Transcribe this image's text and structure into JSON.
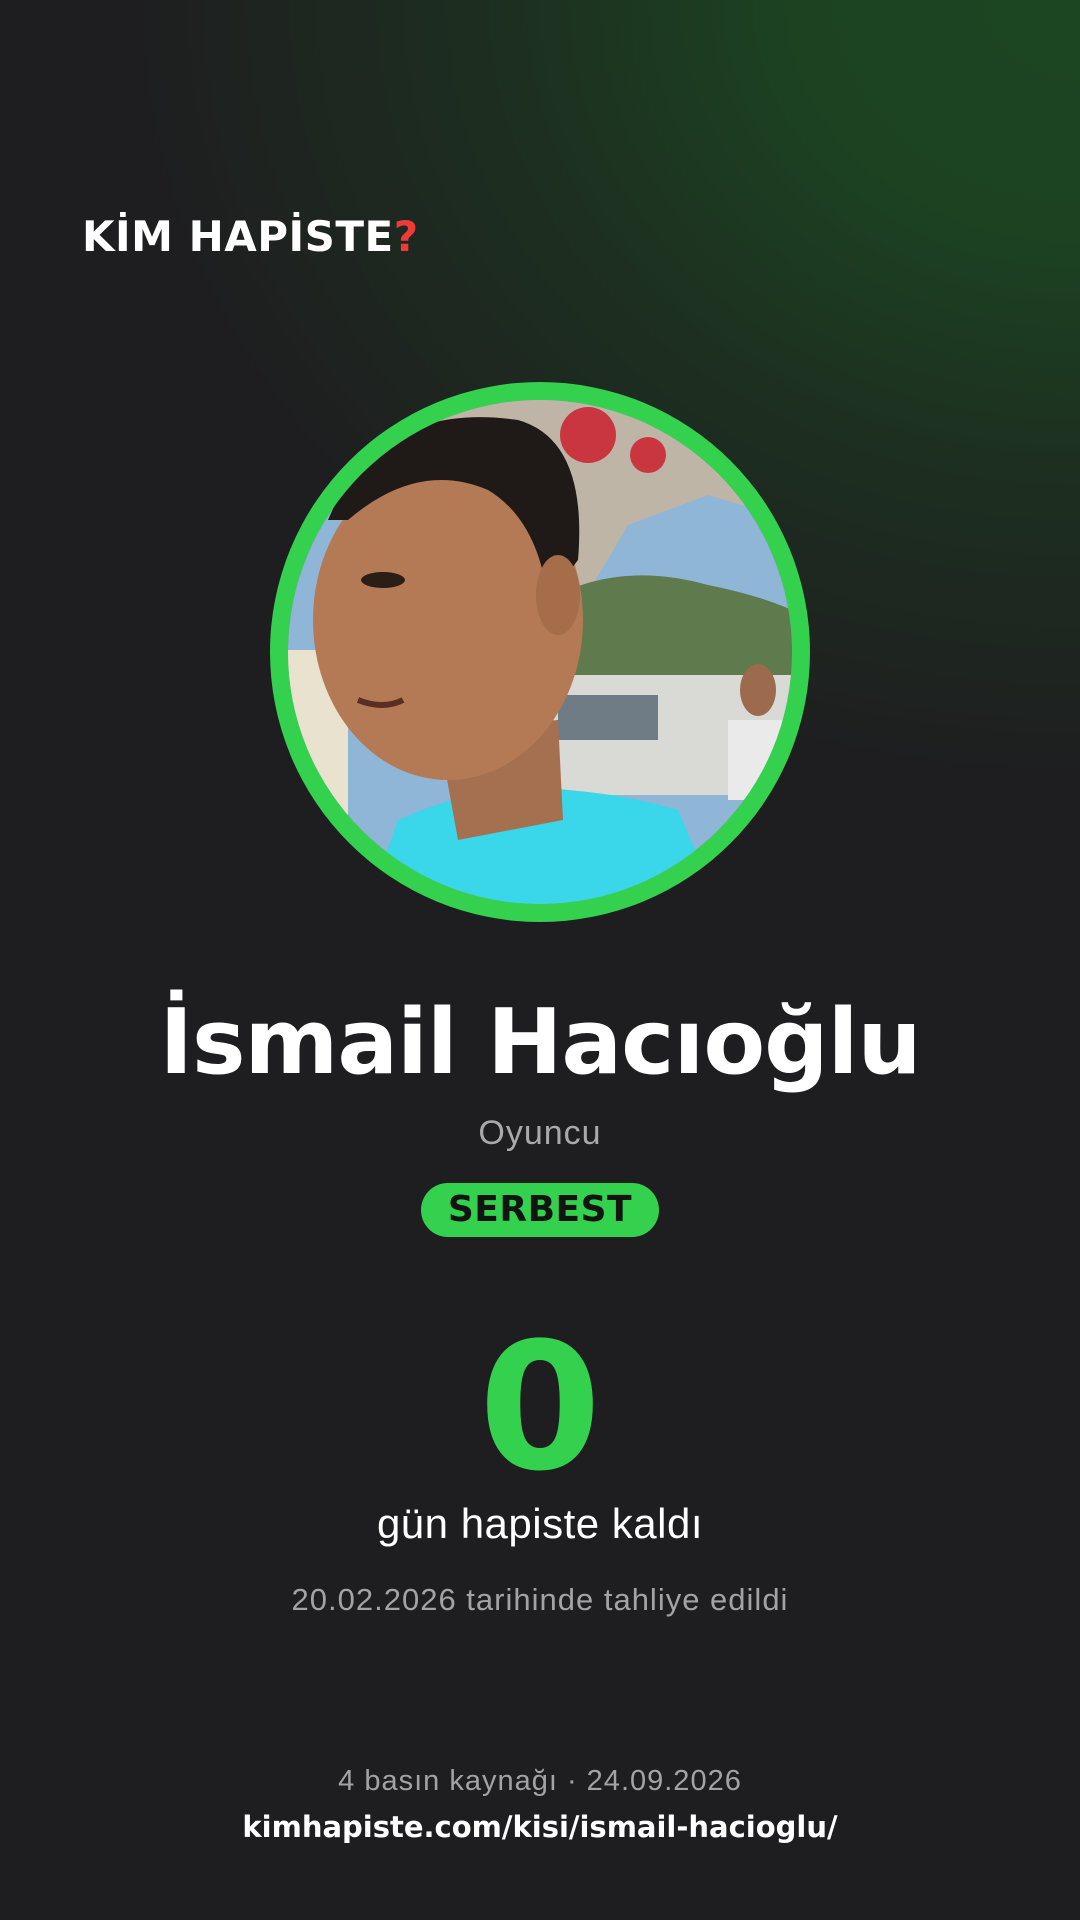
{
  "brand": {
    "logo_text": "KİM HAPİSTE",
    "logo_mark": "?",
    "accent": "#34d14f",
    "mark_color": "#ef3b36"
  },
  "profile": {
    "photo_alt": "İsmail Hacıoğlu",
    "name": "İsmail Hacıoğlu",
    "role": "Oyuncu",
    "status": "SERBEST",
    "days_count": "0",
    "days_label": "gün hapiste kaldı",
    "release_text": "20.02.2026 tarihinde tahliye edildi"
  },
  "footer": {
    "sources_text": "4 basın kaynağı · 24.09.2026",
    "url": "kimhapiste.com/kisi/ismail-hacioglu/"
  }
}
